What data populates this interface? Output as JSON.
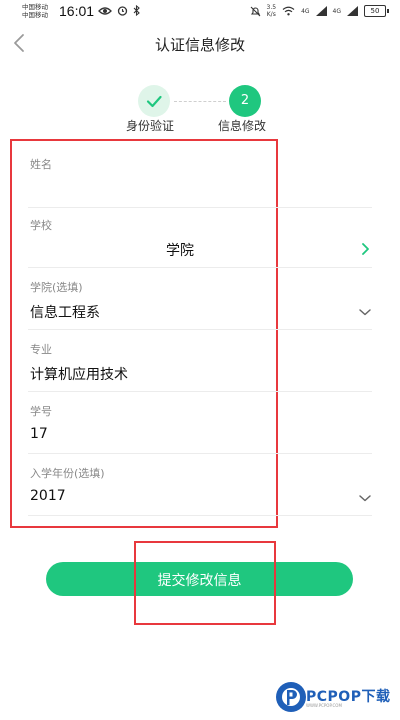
{
  "status_bar": {
    "carrier1": "中国移动",
    "carrier2": "中国移动",
    "time": "16:01",
    "net_speed_value": "3.5",
    "net_speed_unit": "K/s",
    "signal1_label": "4G",
    "signal2_label": "4G",
    "battery": "50"
  },
  "header": {
    "title": "认证信息修改"
  },
  "stepper": {
    "steps": [
      {
        "label": "身份验证",
        "state": "done"
      },
      {
        "label": "信息修改",
        "state": "current",
        "number": "2"
      }
    ]
  },
  "form": {
    "fields": [
      {
        "label": "姓名",
        "value": ""
      },
      {
        "label": "学校",
        "value": "学院"
      },
      {
        "label": "学院(选填)",
        "value": "信息工程系"
      },
      {
        "label": "专业",
        "value": "计算机应用技术"
      },
      {
        "label": "学号",
        "value": "17"
      },
      {
        "label": "入学年份(选填)",
        "value": "2017"
      }
    ]
  },
  "submit": {
    "label": "提交修改信息"
  },
  "watermark": {
    "text": "PCPOP下载",
    "sub": "WWW.PCPOP.COM"
  },
  "colors": {
    "accent": "#1fc77f",
    "highlight": "#e8383d"
  }
}
